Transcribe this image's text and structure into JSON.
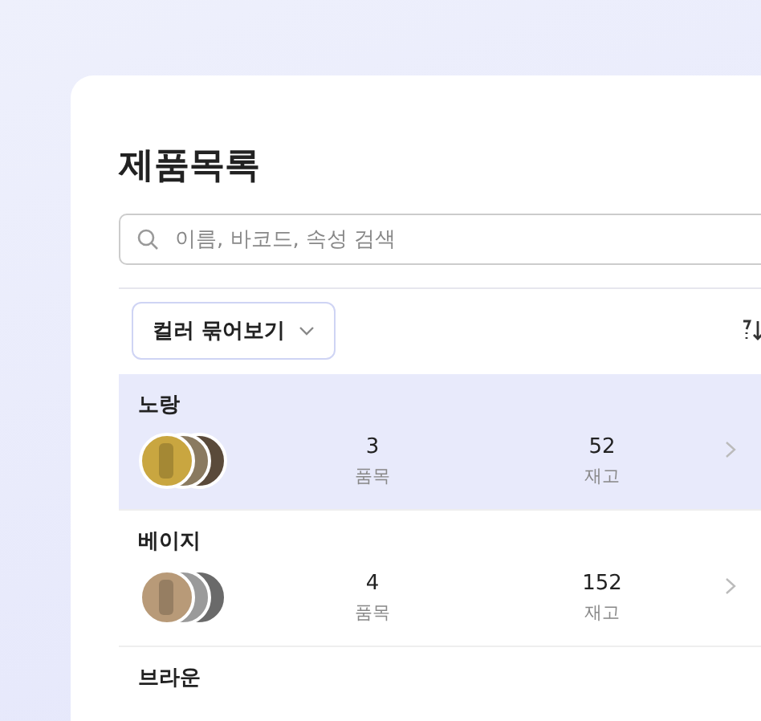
{
  "title": "제품목록",
  "search": {
    "placeholder": "이름, 바코드, 속성 검색"
  },
  "group_button": {
    "label": "컬러 묶어보기"
  },
  "rows": [
    {
      "name": "노랑",
      "selected": true,
      "items": "3",
      "items_label": "품목",
      "stock": "52",
      "stock_label": "재고"
    },
    {
      "name": "베이지",
      "selected": false,
      "items": "4",
      "items_label": "품목",
      "stock": "152",
      "stock_label": "재고"
    },
    {
      "name": "브라운",
      "selected": false
    }
  ]
}
